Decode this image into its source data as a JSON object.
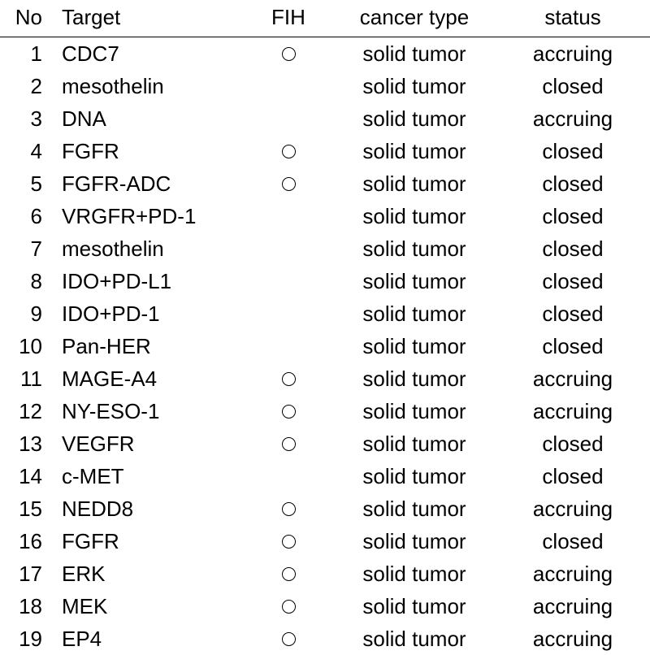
{
  "headers": {
    "no": "No",
    "target": "Target",
    "fih": "FIH",
    "cancer": "cancer type",
    "status": "status"
  },
  "rows": [
    {
      "no": "1",
      "target": "CDC7",
      "fih": true,
      "cancer": "solid tumor",
      "status": "accruing"
    },
    {
      "no": "2",
      "target": "mesothelin",
      "fih": false,
      "cancer": "solid tumor",
      "status": "closed"
    },
    {
      "no": "3",
      "target": "DNA",
      "fih": false,
      "cancer": "solid tumor",
      "status": "accruing"
    },
    {
      "no": "4",
      "target": "FGFR",
      "fih": true,
      "cancer": "solid tumor",
      "status": "closed"
    },
    {
      "no": "5",
      "target": "FGFR-ADC",
      "fih": true,
      "cancer": "solid tumor",
      "status": "closed"
    },
    {
      "no": "6",
      "target": "VRGFR+PD-1",
      "fih": false,
      "cancer": "solid tumor",
      "status": "closed"
    },
    {
      "no": "7",
      "target": "mesothelin",
      "fih": false,
      "cancer": "solid tumor",
      "status": "closed"
    },
    {
      "no": "8",
      "target": "IDO+PD-L1",
      "fih": false,
      "cancer": "solid tumor",
      "status": "closed"
    },
    {
      "no": "9",
      "target": "IDO+PD-1",
      "fih": false,
      "cancer": "solid tumor",
      "status": "closed"
    },
    {
      "no": "10",
      "target": "Pan-HER",
      "fih": false,
      "cancer": "solid tumor",
      "status": "closed"
    },
    {
      "no": "11",
      "target": "MAGE-A4",
      "fih": true,
      "cancer": "solid tumor",
      "status": "accruing"
    },
    {
      "no": "12",
      "target": "NY-ESO-1",
      "fih": true,
      "cancer": "solid tumor",
      "status": "accruing"
    },
    {
      "no": "13",
      "target": "VEGFR",
      "fih": true,
      "cancer": "solid tumor",
      "status": "closed"
    },
    {
      "no": "14",
      "target": "c-MET",
      "fih": false,
      "cancer": "solid tumor",
      "status": "closed"
    },
    {
      "no": "15",
      "target": "NEDD8",
      "fih": true,
      "cancer": "solid tumor",
      "status": "accruing"
    },
    {
      "no": "16",
      "target": "FGFR",
      "fih": true,
      "cancer": "solid tumor",
      "status": "closed"
    },
    {
      "no": "17",
      "target": "ERK",
      "fih": true,
      "cancer": "solid tumor",
      "status": "accruing"
    },
    {
      "no": "18",
      "target": "MEK",
      "fih": true,
      "cancer": "solid tumor",
      "status": "accruing"
    },
    {
      "no": "19",
      "target": "EP4",
      "fih": true,
      "cancer": "solid tumor",
      "status": "accruing"
    }
  ]
}
